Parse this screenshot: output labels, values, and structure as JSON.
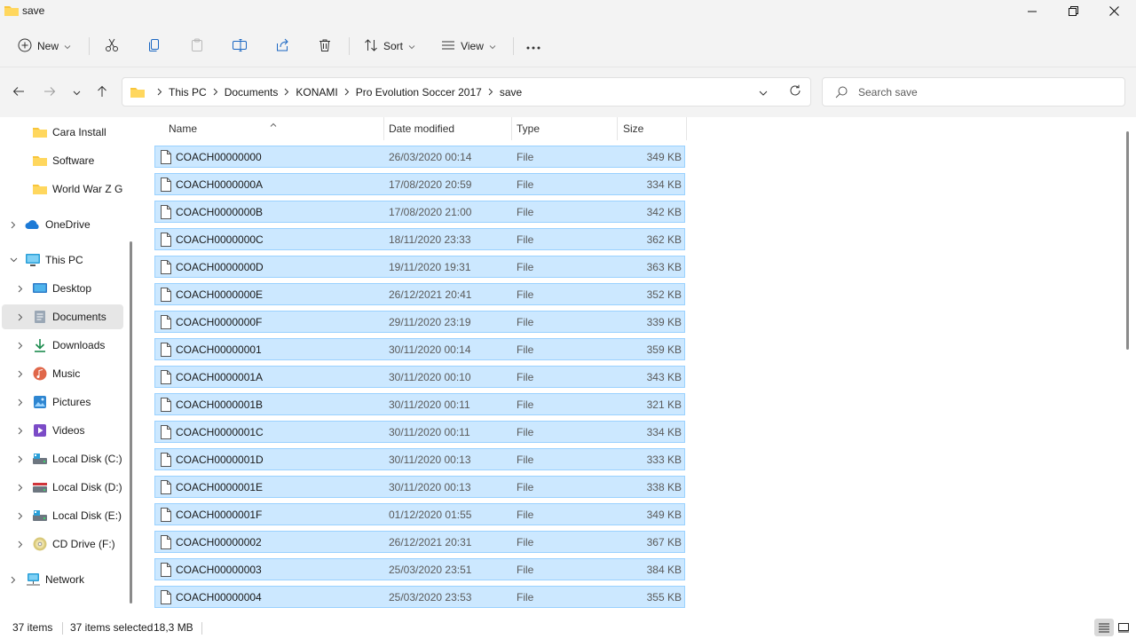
{
  "window": {
    "title": "save"
  },
  "toolbar": {
    "new_label": "New",
    "sort_label": "Sort",
    "view_label": "View"
  },
  "breadcrumb": [
    "This PC",
    "Documents",
    "KONAMI",
    "Pro Evolution Soccer 2017",
    "save"
  ],
  "search": {
    "placeholder": "Search save"
  },
  "nav": {
    "items": [
      {
        "label": "Cara Install",
        "icon": "folder-icon"
      },
      {
        "label": "Software",
        "icon": "folder-icon"
      },
      {
        "label": "World War Z GOG",
        "icon": "folder-icon"
      },
      {
        "label": "OneDrive",
        "icon": "cloud-icon"
      },
      {
        "label": "This PC",
        "icon": "computer-icon"
      },
      {
        "label": "Desktop",
        "icon": "desktop-icon"
      },
      {
        "label": "Documents",
        "icon": "documents-icon"
      },
      {
        "label": "Downloads",
        "icon": "download-icon"
      },
      {
        "label": "Music",
        "icon": "music-icon"
      },
      {
        "label": "Pictures",
        "icon": "pictures-icon"
      },
      {
        "label": "Videos",
        "icon": "videos-icon"
      },
      {
        "label": "Local Disk (C:)",
        "icon": "drive-icon"
      },
      {
        "label": "Local Disk (D:)",
        "icon": "drive-icon"
      },
      {
        "label": "Local Disk (E:)",
        "icon": "drive-icon"
      },
      {
        "label": "CD Drive (F:)",
        "icon": "cd-drive-icon"
      },
      {
        "label": "Network",
        "icon": "network-icon"
      }
    ]
  },
  "columns": {
    "name": "Name",
    "date": "Date modified",
    "type": "Type",
    "size": "Size"
  },
  "files": [
    {
      "name": "COACH00000000",
      "date": "26/03/2020 00:14",
      "type": "File",
      "size": "349 KB"
    },
    {
      "name": "COACH0000000A",
      "date": "17/08/2020 20:59",
      "type": "File",
      "size": "334 KB"
    },
    {
      "name": "COACH0000000B",
      "date": "17/08/2020 21:00",
      "type": "File",
      "size": "342 KB"
    },
    {
      "name": "COACH0000000C",
      "date": "18/11/2020 23:33",
      "type": "File",
      "size": "362 KB"
    },
    {
      "name": "COACH0000000D",
      "date": "19/11/2020 19:31",
      "type": "File",
      "size": "363 KB"
    },
    {
      "name": "COACH0000000E",
      "date": "26/12/2021 20:41",
      "type": "File",
      "size": "352 KB"
    },
    {
      "name": "COACH0000000F",
      "date": "29/11/2020 23:19",
      "type": "File",
      "size": "339 KB"
    },
    {
      "name": "COACH00000001",
      "date": "30/11/2020 00:14",
      "type": "File",
      "size": "359 KB"
    },
    {
      "name": "COACH0000001A",
      "date": "30/11/2020 00:10",
      "type": "File",
      "size": "343 KB"
    },
    {
      "name": "COACH0000001B",
      "date": "30/11/2020 00:11",
      "type": "File",
      "size": "321 KB"
    },
    {
      "name": "COACH0000001C",
      "date": "30/11/2020 00:11",
      "type": "File",
      "size": "334 KB"
    },
    {
      "name": "COACH0000001D",
      "date": "30/11/2020 00:13",
      "type": "File",
      "size": "333 KB"
    },
    {
      "name": "COACH0000001E",
      "date": "30/11/2020 00:13",
      "type": "File",
      "size": "338 KB"
    },
    {
      "name": "COACH0000001F",
      "date": "01/12/2020 01:55",
      "type": "File",
      "size": "349 KB"
    },
    {
      "name": "COACH00000002",
      "date": "26/12/2021 20:31",
      "type": "File",
      "size": "367 KB"
    },
    {
      "name": "COACH00000003",
      "date": "25/03/2020 23:51",
      "type": "File",
      "size": "384 KB"
    },
    {
      "name": "COACH00000004",
      "date": "25/03/2020 23:53",
      "type": "File",
      "size": "355 KB"
    }
  ],
  "status": {
    "item_count": "37 items",
    "selected": "37 items selected",
    "selected_size": "18,3 MB"
  },
  "colors": {
    "selection_bg": "#cce8ff",
    "selection_border": "#99d1ff",
    "folder": "#f8c53a",
    "chrome_bg": "#f3f3f3"
  }
}
